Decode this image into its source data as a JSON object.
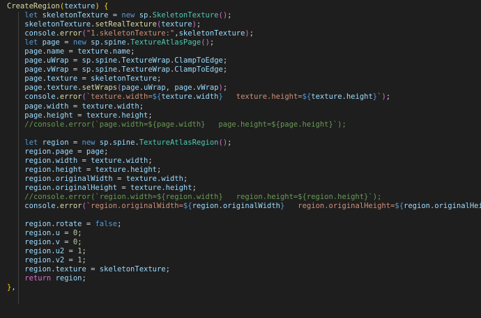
{
  "editor": {
    "theme_colors": {
      "background": "#1e1e1e",
      "keyword": "#569cd6",
      "function": "#dcdcaa",
      "variable": "#9cdcfe",
      "string": "#ce9178",
      "comment": "#6a9955",
      "number": "#b5cea8",
      "type": "#4ec9b0"
    },
    "lines": [
      [
        {
          "t": "f",
          "v": "CreateRegion"
        },
        {
          "t": "br",
          "v": "("
        },
        {
          "t": "v",
          "v": "texture"
        },
        {
          "t": "br",
          "v": ")"
        },
        {
          "t": "p",
          "v": " "
        },
        {
          "t": "br",
          "v": "{"
        }
      ],
      [
        {
          "t": "p",
          "v": "    "
        },
        {
          "t": "k",
          "v": "let"
        },
        {
          "t": "p",
          "v": " "
        },
        {
          "t": "v",
          "v": "skeletonTexture"
        },
        {
          "t": "p",
          "v": " = "
        },
        {
          "t": "k",
          "v": "new"
        },
        {
          "t": "p",
          "v": " "
        },
        {
          "t": "v",
          "v": "sp"
        },
        {
          "t": "p",
          "v": "."
        },
        {
          "t": "t",
          "v": "SkeletonTexture"
        },
        {
          "t": "bp",
          "v": "("
        },
        {
          "t": "bp",
          "v": ")"
        },
        {
          "t": "p",
          "v": ";"
        }
      ],
      [
        {
          "t": "p",
          "v": "    "
        },
        {
          "t": "v",
          "v": "skeletonTexture"
        },
        {
          "t": "p",
          "v": "."
        },
        {
          "t": "f",
          "v": "setRealTexture"
        },
        {
          "t": "bp",
          "v": "("
        },
        {
          "t": "v",
          "v": "texture"
        },
        {
          "t": "bp",
          "v": ")"
        },
        {
          "t": "p",
          "v": ";"
        }
      ],
      [
        {
          "t": "p",
          "v": "    "
        },
        {
          "t": "v",
          "v": "console"
        },
        {
          "t": "p",
          "v": "."
        },
        {
          "t": "f",
          "v": "error"
        },
        {
          "t": "bp",
          "v": "("
        },
        {
          "t": "s",
          "v": "\"1.skeletonTexture:\""
        },
        {
          "t": "p",
          "v": ","
        },
        {
          "t": "v",
          "v": "skeletonTexture"
        },
        {
          "t": "bp",
          "v": ")"
        },
        {
          "t": "p",
          "v": ";"
        }
      ],
      [
        {
          "t": "p",
          "v": "    "
        },
        {
          "t": "k",
          "v": "let"
        },
        {
          "t": "p",
          "v": " "
        },
        {
          "t": "v",
          "v": "page"
        },
        {
          "t": "p",
          "v": " = "
        },
        {
          "t": "k",
          "v": "new"
        },
        {
          "t": "p",
          "v": " "
        },
        {
          "t": "v",
          "v": "sp"
        },
        {
          "t": "p",
          "v": "."
        },
        {
          "t": "v",
          "v": "spine"
        },
        {
          "t": "p",
          "v": "."
        },
        {
          "t": "t",
          "v": "TextureAtlasPage"
        },
        {
          "t": "bp",
          "v": "("
        },
        {
          "t": "bp",
          "v": ")"
        },
        {
          "t": "p",
          "v": ";"
        }
      ],
      [
        {
          "t": "p",
          "v": "    "
        },
        {
          "t": "v",
          "v": "page"
        },
        {
          "t": "p",
          "v": "."
        },
        {
          "t": "v",
          "v": "name"
        },
        {
          "t": "p",
          "v": " = "
        },
        {
          "t": "v",
          "v": "texture"
        },
        {
          "t": "p",
          "v": "."
        },
        {
          "t": "v",
          "v": "name"
        },
        {
          "t": "p",
          "v": ";"
        }
      ],
      [
        {
          "t": "p",
          "v": "    "
        },
        {
          "t": "v",
          "v": "page"
        },
        {
          "t": "p",
          "v": "."
        },
        {
          "t": "v",
          "v": "uWrap"
        },
        {
          "t": "p",
          "v": " = "
        },
        {
          "t": "v",
          "v": "sp"
        },
        {
          "t": "p",
          "v": "."
        },
        {
          "t": "v",
          "v": "spine"
        },
        {
          "t": "p",
          "v": "."
        },
        {
          "t": "v",
          "v": "TextureWrap"
        },
        {
          "t": "p",
          "v": "."
        },
        {
          "t": "v",
          "v": "ClampToEdge"
        },
        {
          "t": "p",
          "v": ";"
        }
      ],
      [
        {
          "t": "p",
          "v": "    "
        },
        {
          "t": "v",
          "v": "page"
        },
        {
          "t": "p",
          "v": "."
        },
        {
          "t": "v",
          "v": "vWrap"
        },
        {
          "t": "p",
          "v": " = "
        },
        {
          "t": "v",
          "v": "sp"
        },
        {
          "t": "p",
          "v": "."
        },
        {
          "t": "v",
          "v": "spine"
        },
        {
          "t": "p",
          "v": "."
        },
        {
          "t": "v",
          "v": "TextureWrap"
        },
        {
          "t": "p",
          "v": "."
        },
        {
          "t": "v",
          "v": "ClampToEdge"
        },
        {
          "t": "p",
          "v": ";"
        }
      ],
      [
        {
          "t": "p",
          "v": "    "
        },
        {
          "t": "v",
          "v": "page"
        },
        {
          "t": "p",
          "v": "."
        },
        {
          "t": "v",
          "v": "texture"
        },
        {
          "t": "p",
          "v": " = "
        },
        {
          "t": "v",
          "v": "skeletonTexture"
        },
        {
          "t": "p",
          "v": ";"
        }
      ],
      [
        {
          "t": "p",
          "v": "    "
        },
        {
          "t": "v",
          "v": "page"
        },
        {
          "t": "p",
          "v": "."
        },
        {
          "t": "v",
          "v": "texture"
        },
        {
          "t": "p",
          "v": "."
        },
        {
          "t": "f",
          "v": "setWraps"
        },
        {
          "t": "bp",
          "v": "("
        },
        {
          "t": "v",
          "v": "page"
        },
        {
          "t": "p",
          "v": "."
        },
        {
          "t": "v",
          "v": "uWrap"
        },
        {
          "t": "p",
          "v": ", "
        },
        {
          "t": "v",
          "v": "page"
        },
        {
          "t": "p",
          "v": "."
        },
        {
          "t": "v",
          "v": "vWrap"
        },
        {
          "t": "bp",
          "v": ")"
        },
        {
          "t": "p",
          "v": ";"
        }
      ],
      [
        {
          "t": "p",
          "v": "    "
        },
        {
          "t": "v",
          "v": "console"
        },
        {
          "t": "p",
          "v": "."
        },
        {
          "t": "f",
          "v": "error"
        },
        {
          "t": "bp",
          "v": "("
        },
        {
          "t": "s",
          "v": "`texture.width="
        },
        {
          "t": "k",
          "v": "${"
        },
        {
          "t": "v",
          "v": "texture.width"
        },
        {
          "t": "k",
          "v": "}"
        },
        {
          "t": "s",
          "v": "   texture.height="
        },
        {
          "t": "k",
          "v": "${"
        },
        {
          "t": "v",
          "v": "texture.height"
        },
        {
          "t": "k",
          "v": "}"
        },
        {
          "t": "s",
          "v": "`"
        },
        {
          "t": "bp",
          "v": ")"
        },
        {
          "t": "p",
          "v": ";"
        }
      ],
      [
        {
          "t": "p",
          "v": "    "
        },
        {
          "t": "v",
          "v": "page"
        },
        {
          "t": "p",
          "v": "."
        },
        {
          "t": "v",
          "v": "width"
        },
        {
          "t": "p",
          "v": " = "
        },
        {
          "t": "v",
          "v": "texture"
        },
        {
          "t": "p",
          "v": "."
        },
        {
          "t": "v",
          "v": "width"
        },
        {
          "t": "p",
          "v": ";"
        }
      ],
      [
        {
          "t": "p",
          "v": "    "
        },
        {
          "t": "v",
          "v": "page"
        },
        {
          "t": "p",
          "v": "."
        },
        {
          "t": "v",
          "v": "height"
        },
        {
          "t": "p",
          "v": " = "
        },
        {
          "t": "v",
          "v": "texture"
        },
        {
          "t": "p",
          "v": "."
        },
        {
          "t": "v",
          "v": "height"
        },
        {
          "t": "p",
          "v": ";"
        }
      ],
      [
        {
          "t": "p",
          "v": "    "
        },
        {
          "t": "c",
          "v": "//console.error(`page.width=${page.width}   page.height=${page.height}`);"
        }
      ],
      [
        {
          "t": "p",
          "v": ""
        }
      ],
      [
        {
          "t": "p",
          "v": "    "
        },
        {
          "t": "k",
          "v": "let"
        },
        {
          "t": "p",
          "v": " "
        },
        {
          "t": "v",
          "v": "region"
        },
        {
          "t": "p",
          "v": " = "
        },
        {
          "t": "k",
          "v": "new"
        },
        {
          "t": "p",
          "v": " "
        },
        {
          "t": "v",
          "v": "sp"
        },
        {
          "t": "p",
          "v": "."
        },
        {
          "t": "v",
          "v": "spine"
        },
        {
          "t": "p",
          "v": "."
        },
        {
          "t": "t",
          "v": "TextureAtlasRegion"
        },
        {
          "t": "bp",
          "v": "("
        },
        {
          "t": "bp",
          "v": ")"
        },
        {
          "t": "p",
          "v": ";"
        }
      ],
      [
        {
          "t": "p",
          "v": "    "
        },
        {
          "t": "v",
          "v": "region"
        },
        {
          "t": "p",
          "v": "."
        },
        {
          "t": "v",
          "v": "page"
        },
        {
          "t": "p",
          "v": " = "
        },
        {
          "t": "v",
          "v": "page"
        },
        {
          "t": "p",
          "v": ";"
        }
      ],
      [
        {
          "t": "p",
          "v": "    "
        },
        {
          "t": "v",
          "v": "region"
        },
        {
          "t": "p",
          "v": "."
        },
        {
          "t": "v",
          "v": "width"
        },
        {
          "t": "p",
          "v": " = "
        },
        {
          "t": "v",
          "v": "texture"
        },
        {
          "t": "p",
          "v": "."
        },
        {
          "t": "v",
          "v": "width"
        },
        {
          "t": "p",
          "v": ";"
        }
      ],
      [
        {
          "t": "p",
          "v": "    "
        },
        {
          "t": "v",
          "v": "region"
        },
        {
          "t": "p",
          "v": "."
        },
        {
          "t": "v",
          "v": "height"
        },
        {
          "t": "p",
          "v": " = "
        },
        {
          "t": "v",
          "v": "texture"
        },
        {
          "t": "p",
          "v": "."
        },
        {
          "t": "v",
          "v": "height"
        },
        {
          "t": "p",
          "v": ";"
        }
      ],
      [
        {
          "t": "p",
          "v": "    "
        },
        {
          "t": "v",
          "v": "region"
        },
        {
          "t": "p",
          "v": "."
        },
        {
          "t": "v",
          "v": "originalWidth"
        },
        {
          "t": "p",
          "v": " = "
        },
        {
          "t": "v",
          "v": "texture"
        },
        {
          "t": "p",
          "v": "."
        },
        {
          "t": "v",
          "v": "width"
        },
        {
          "t": "p",
          "v": ";"
        }
      ],
      [
        {
          "t": "p",
          "v": "    "
        },
        {
          "t": "v",
          "v": "region"
        },
        {
          "t": "p",
          "v": "."
        },
        {
          "t": "v",
          "v": "originalHeight"
        },
        {
          "t": "p",
          "v": " = "
        },
        {
          "t": "v",
          "v": "texture"
        },
        {
          "t": "p",
          "v": "."
        },
        {
          "t": "v",
          "v": "height"
        },
        {
          "t": "p",
          "v": ";"
        }
      ],
      [
        {
          "t": "p",
          "v": "    "
        },
        {
          "t": "c",
          "v": "//console.error(`region.width=${region.width}   region.height=${region.height}`);"
        }
      ],
      [
        {
          "t": "p",
          "v": "    "
        },
        {
          "t": "v",
          "v": "console"
        },
        {
          "t": "p",
          "v": "."
        },
        {
          "t": "f",
          "v": "error"
        },
        {
          "t": "bp",
          "v": "("
        },
        {
          "t": "s",
          "v": "`region.originalWidth="
        },
        {
          "t": "k",
          "v": "${"
        },
        {
          "t": "v",
          "v": "region.originalWidth"
        },
        {
          "t": "k",
          "v": "}"
        },
        {
          "t": "s",
          "v": "   region.originalHeight="
        },
        {
          "t": "k",
          "v": "${"
        },
        {
          "t": "v",
          "v": "region.originalHeight"
        },
        {
          "t": "k",
          "v": "}"
        },
        {
          "t": "s",
          "v": "`"
        },
        {
          "t": "bp",
          "v": ")"
        },
        {
          "t": "p",
          "v": ";"
        }
      ],
      [
        {
          "t": "p",
          "v": ""
        }
      ],
      [
        {
          "t": "p",
          "v": "    "
        },
        {
          "t": "v",
          "v": "region"
        },
        {
          "t": "p",
          "v": "."
        },
        {
          "t": "v",
          "v": "rotate"
        },
        {
          "t": "p",
          "v": " = "
        },
        {
          "t": "k",
          "v": "false"
        },
        {
          "t": "p",
          "v": ";"
        }
      ],
      [
        {
          "t": "p",
          "v": "    "
        },
        {
          "t": "v",
          "v": "region"
        },
        {
          "t": "p",
          "v": "."
        },
        {
          "t": "v",
          "v": "u"
        },
        {
          "t": "p",
          "v": " = "
        },
        {
          "t": "n",
          "v": "0"
        },
        {
          "t": "p",
          "v": ";"
        }
      ],
      [
        {
          "t": "p",
          "v": "    "
        },
        {
          "t": "v",
          "v": "region"
        },
        {
          "t": "p",
          "v": "."
        },
        {
          "t": "v",
          "v": "v"
        },
        {
          "t": "p",
          "v": " = "
        },
        {
          "t": "n",
          "v": "0"
        },
        {
          "t": "p",
          "v": ";"
        }
      ],
      [
        {
          "t": "p",
          "v": "    "
        },
        {
          "t": "v",
          "v": "region"
        },
        {
          "t": "p",
          "v": "."
        },
        {
          "t": "v",
          "v": "u2"
        },
        {
          "t": "p",
          "v": " = "
        },
        {
          "t": "n",
          "v": "1"
        },
        {
          "t": "p",
          "v": ";"
        }
      ],
      [
        {
          "t": "p",
          "v": "    "
        },
        {
          "t": "v",
          "v": "region"
        },
        {
          "t": "p",
          "v": "."
        },
        {
          "t": "v",
          "v": "v2"
        },
        {
          "t": "p",
          "v": " = "
        },
        {
          "t": "n",
          "v": "1"
        },
        {
          "t": "p",
          "v": ";"
        }
      ],
      [
        {
          "t": "p",
          "v": "    "
        },
        {
          "t": "v",
          "v": "region"
        },
        {
          "t": "p",
          "v": "."
        },
        {
          "t": "v",
          "v": "texture"
        },
        {
          "t": "p",
          "v": " = "
        },
        {
          "t": "v",
          "v": "skeletonTexture"
        },
        {
          "t": "p",
          "v": ";"
        }
      ],
      [
        {
          "t": "p",
          "v": "    "
        },
        {
          "t": "bp",
          "v": "return"
        },
        {
          "t": "p",
          "v": " "
        },
        {
          "t": "v",
          "v": "region"
        },
        {
          "t": "p",
          "v": ";"
        }
      ],
      [
        {
          "t": "br",
          "v": "}"
        },
        {
          "t": "p",
          "v": ","
        }
      ]
    ]
  }
}
